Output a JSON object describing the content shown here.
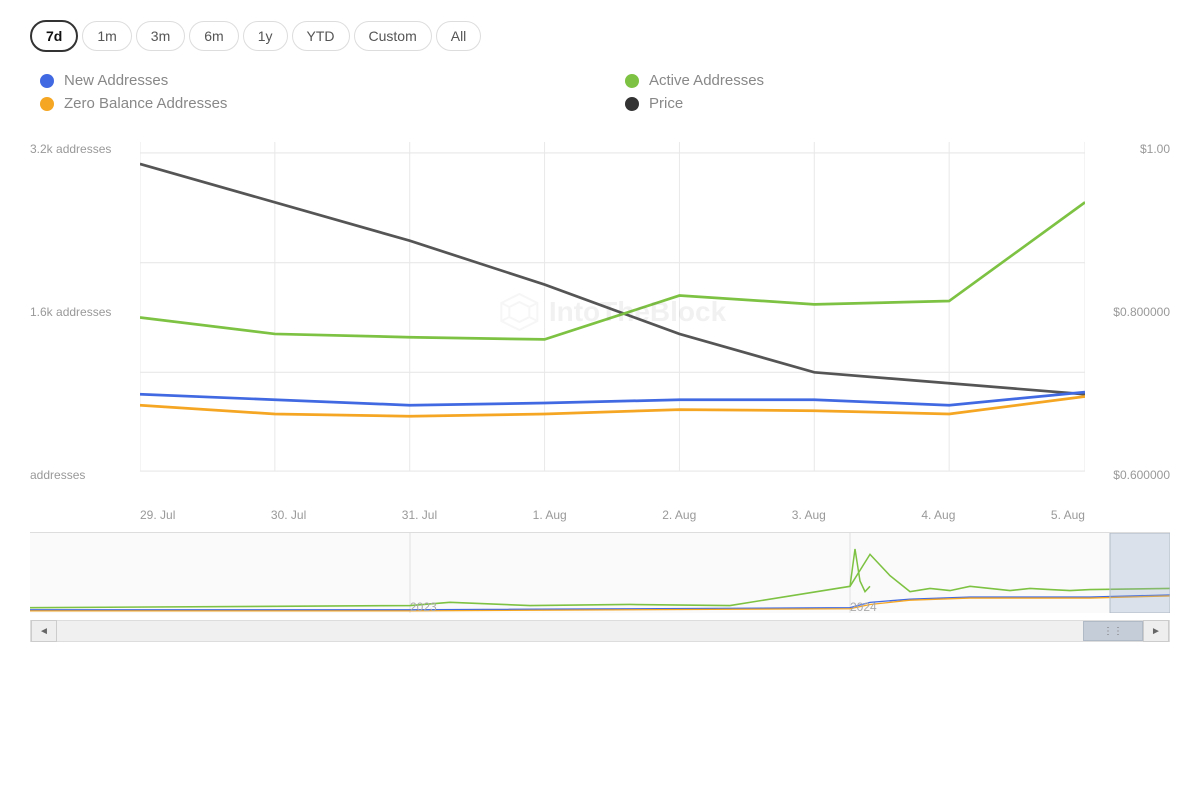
{
  "timeRange": {
    "buttons": [
      "7d",
      "1m",
      "3m",
      "6m",
      "1y",
      "YTD",
      "Custom",
      "All"
    ],
    "active": "7d"
  },
  "legend": {
    "items": [
      {
        "id": "new-addresses",
        "label": "New Addresses",
        "color": "#4169e1"
      },
      {
        "id": "active-addresses",
        "label": "Active Addresses",
        "color": "#7dc242"
      },
      {
        "id": "zero-balance",
        "label": "Zero Balance Addresses",
        "color": "#f5a623"
      },
      {
        "id": "price",
        "label": "Price",
        "color": "#333333"
      }
    ]
  },
  "yAxis": {
    "left": [
      "3.2k addresses",
      "1.6k addresses",
      "addresses"
    ],
    "right": [
      "$1.00",
      "$0.800000",
      "$0.600000"
    ]
  },
  "xAxis": {
    "labels": [
      "29. Jul",
      "30. Jul",
      "31. Jul",
      "1. Aug",
      "2. Aug",
      "3. Aug",
      "4. Aug",
      "5. Aug"
    ]
  },
  "watermark": {
    "text": "IntoTheBlock"
  },
  "navigator": {
    "yearLabels": [
      {
        "label": "2023",
        "xPercent": 34
      },
      {
        "label": "2024",
        "xPercent": 72
      }
    ]
  },
  "scrollbar": {
    "leftArrow": "◄",
    "rightArrow": "►",
    "handleIcon": "⋮⋮"
  }
}
